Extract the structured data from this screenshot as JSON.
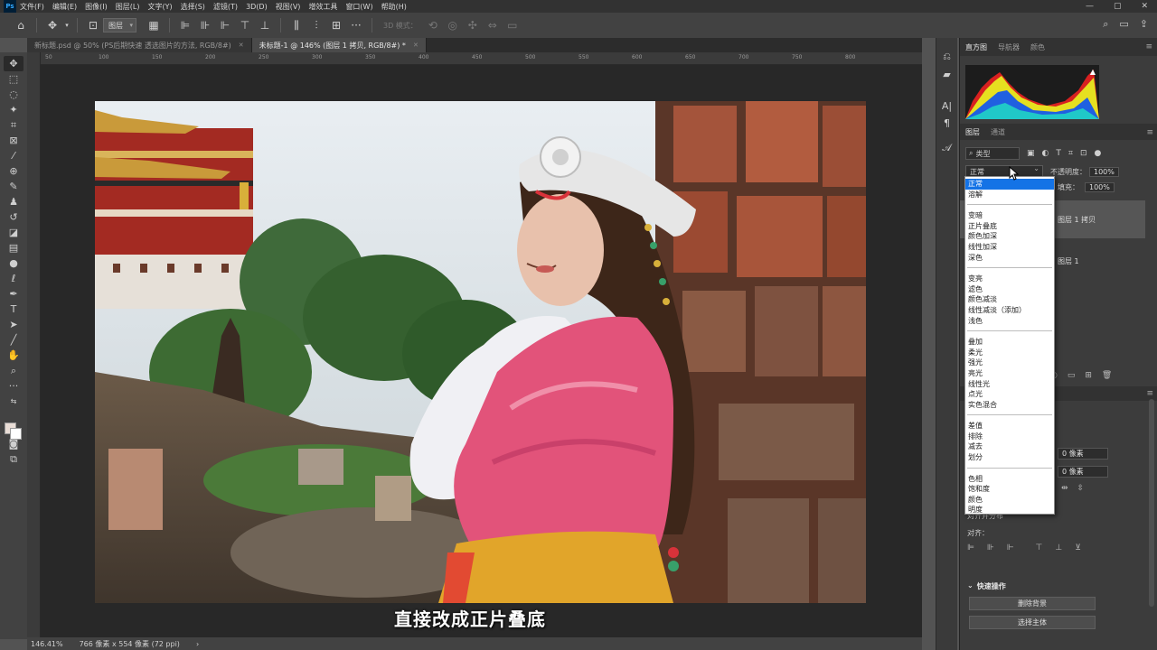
{
  "menubar": {
    "logo": "Ps",
    "items": [
      "文件(F)",
      "编辑(E)",
      "图像(I)",
      "图层(L)",
      "文字(Y)",
      "选择(S)",
      "滤镜(T)",
      "3D(D)",
      "视图(V)",
      "增效工具",
      "窗口(W)",
      "帮助(H)"
    ],
    "window_controls": [
      "—",
      "▢",
      "✕"
    ]
  },
  "options_bar": {
    "layer_select": "图层",
    "mode_3d": "3D 模式："
  },
  "tabs": [
    {
      "label": "新标题.psd @ 50% (PS后期快速 透选图片的方法, RGB/8#)",
      "active": false
    },
    {
      "label": "未标题-1 @ 146% (图层 1 拷贝, RGB/8#) *",
      "active": true
    }
  ],
  "ruler": {
    "marks": [
      "50",
      "100",
      "150",
      "200",
      "250",
      "300",
      "350",
      "400",
      "450",
      "500",
      "550",
      "600",
      "650",
      "700",
      "750",
      "800"
    ]
  },
  "subtitle": "直接改成正片叠底",
  "status": {
    "zoom": "146.41%",
    "doc_info": "766 像素 x 554 像素 (72 ppi)",
    "arrow": "›"
  },
  "panels": {
    "top_tabs": [
      "直方图",
      "导航器",
      "颜色"
    ],
    "layers_tabs": [
      "图层",
      "通道"
    ],
    "filter_label": "类型",
    "blend_mode": "正常",
    "opacity_label": "不透明度：",
    "opacity_value": "100%",
    "fill_label": "填充：",
    "fill_value": "100%",
    "layers": [
      "图层 1 拷贝",
      "图层 1"
    ],
    "pixel_field_1": "0 像素",
    "pixel_field_2": "0 像素",
    "align_label": "对齐：",
    "align_partial": "对齐并分布",
    "quick_actions_title": "快速操作",
    "quick_actions": [
      "删除背景",
      "选择主体"
    ]
  },
  "blend_dropdown": {
    "selected": "正常",
    "groups": [
      [
        "正常",
        "溶解"
      ],
      [
        "变暗",
        "正片叠底",
        "颜色加深",
        "线性加深",
        "深色"
      ],
      [
        "变亮",
        "滤色",
        "颜色减淡",
        "线性减淡（添加）",
        "浅色"
      ],
      [
        "叠加",
        "柔光",
        "强光",
        "亮光",
        "线性光",
        "点光",
        "实色混合"
      ],
      [
        "差值",
        "排除",
        "减去",
        "划分"
      ],
      [
        "色相",
        "饱和度",
        "颜色",
        "明度"
      ]
    ]
  },
  "colors": {
    "selected_item": "#1473e6",
    "foreground": "#e9ddd6",
    "background": "#ffffff"
  }
}
